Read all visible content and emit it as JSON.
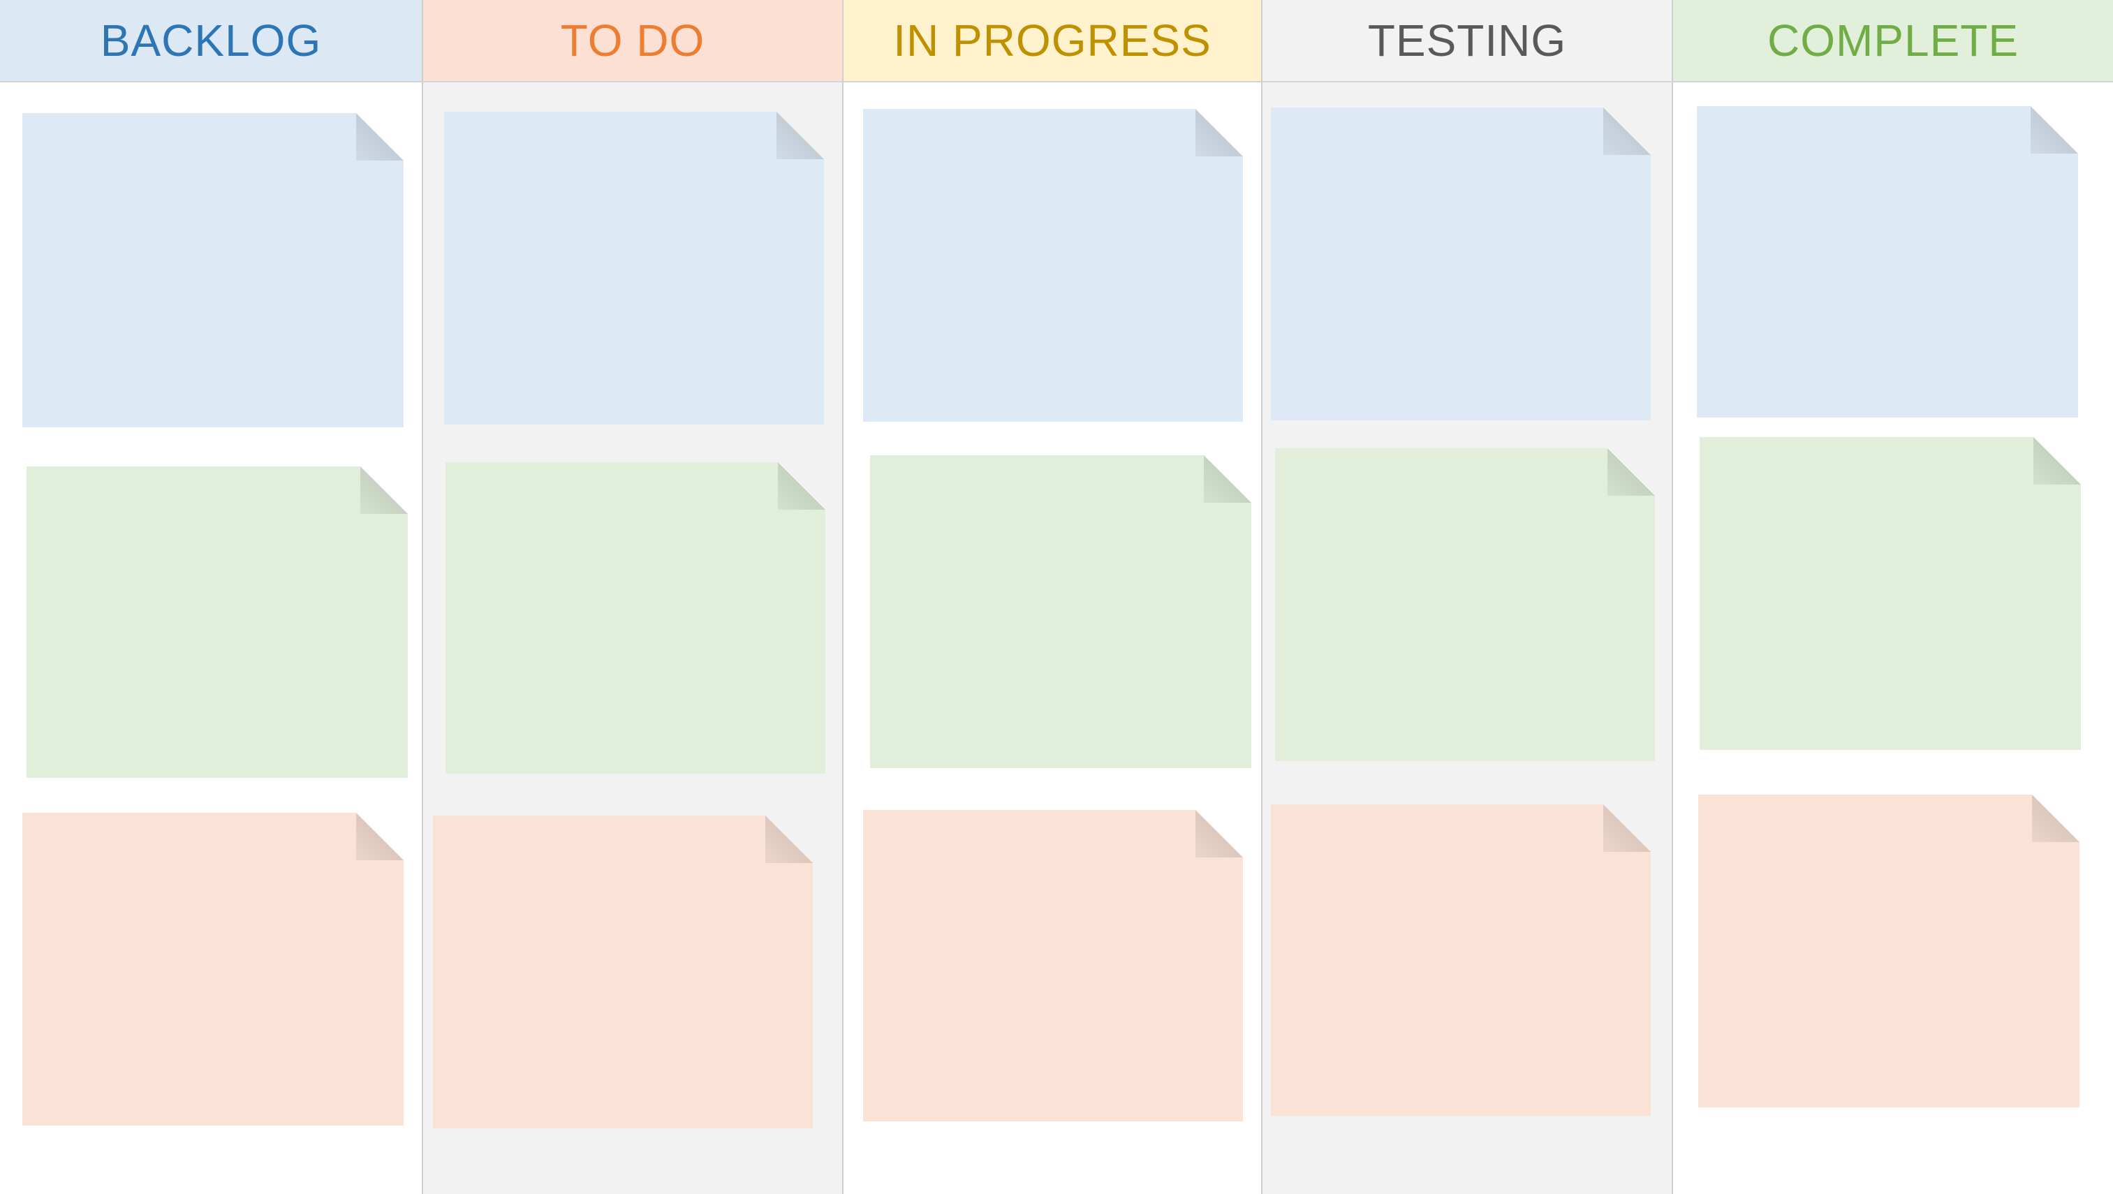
{
  "board": {
    "columns": [
      {
        "title": "BACKLOG",
        "header_color": "#dce9f5",
        "title_color": "#2e75b6",
        "body_color": "#ffffff"
      },
      {
        "title": "TO DO",
        "header_color": "#fce0d3",
        "title_color": "#ed7d31",
        "body_color": "#f2f2f2"
      },
      {
        "title": "IN PROGRESS",
        "header_color": "#fff2cc",
        "title_color": "#bf9000",
        "body_color": "#ffffff"
      },
      {
        "title": "TESTING",
        "header_color": "#f2f2f2",
        "title_color": "#595959",
        "body_color": "#f2f2f2"
      },
      {
        "title": "COMPLETE",
        "header_color": "#e2efda",
        "title_color": "#70ad47",
        "body_color": "#ffffff"
      }
    ],
    "card_colors": {
      "blue": "#dde9f4",
      "green": "#e1efda",
      "orange": "#fae3d6"
    }
  }
}
